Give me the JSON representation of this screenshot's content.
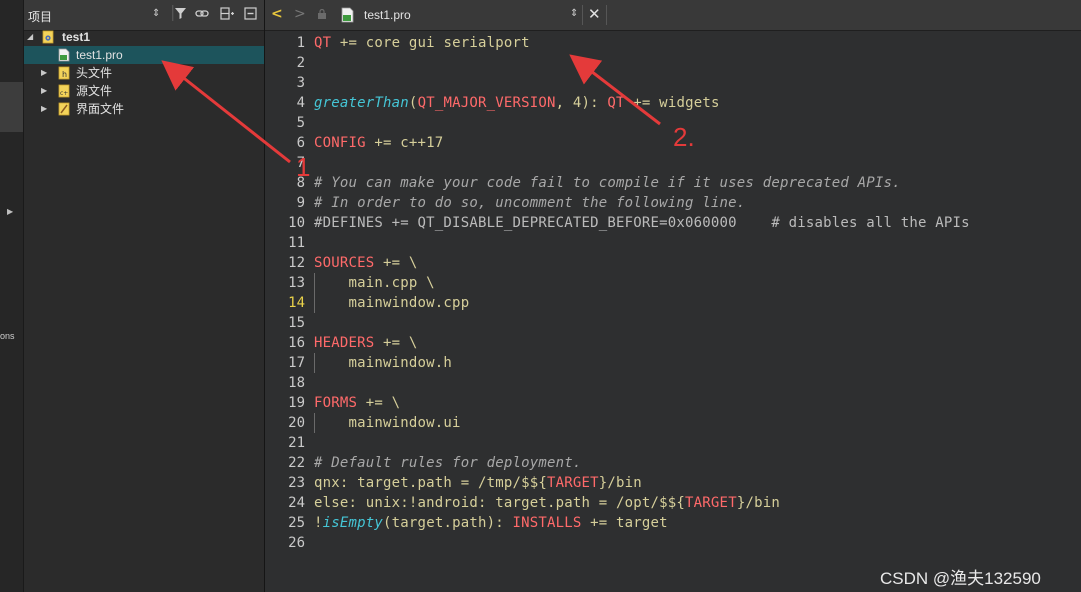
{
  "mode_strip": {
    "partial_label": "ons"
  },
  "project_panel": {
    "title": "项目",
    "tree": [
      {
        "label": "test1",
        "kind": "project",
        "expanded": true
      },
      {
        "label": "test1.pro",
        "kind": "pro-file",
        "selected": true
      },
      {
        "label": "头文件",
        "kind": "headers-folder",
        "expanded": false
      },
      {
        "label": "源文件",
        "kind": "sources-folder",
        "expanded": false
      },
      {
        "label": "界面文件",
        "kind": "forms-folder",
        "expanded": false
      }
    ]
  },
  "editor": {
    "file_name": "test1.pro",
    "current_line": "14",
    "line_numbers": [
      "1",
      "2",
      "3",
      "4",
      "5",
      "6",
      "7",
      "8",
      "9",
      "10",
      "11",
      "12",
      "13",
      "14",
      "15",
      "16",
      "17",
      "18",
      "19",
      "20",
      "21",
      "22",
      "23",
      "24",
      "25",
      "26"
    ],
    "lines": [
      [
        {
          "t": "QT",
          "c": "k"
        },
        {
          "t": " += core gui serialport",
          "c": "p"
        }
      ],
      [],
      [],
      [
        {
          "t": "greaterThan",
          "c": "f"
        },
        {
          "t": "(",
          "c": "p"
        },
        {
          "t": "QT_MAJOR_VERSION",
          "c": "k"
        },
        {
          "t": ", 4): ",
          "c": "p"
        },
        {
          "t": "QT",
          "c": "k"
        },
        {
          "t": " += widgets",
          "c": "p"
        }
      ],
      [],
      [
        {
          "t": "CONFIG",
          "c": "k"
        },
        {
          "t": " += c++17",
          "c": "p"
        }
      ],
      [],
      [
        {
          "t": "# You can make your code fail to compile if it uses deprecated APIs.",
          "c": "c"
        }
      ],
      [
        {
          "t": "# In order to do so, uncomment the following line.",
          "c": "c"
        }
      ],
      [
        {
          "t": "#DEFINES += QT_DISABLE_DEPRECATED_BEFORE=0x060000    # disables all the APIs",
          "c": "d"
        }
      ],
      [],
      [
        {
          "t": "SOURCES",
          "c": "k"
        },
        {
          "t": " += \\",
          "c": "p"
        }
      ],
      [
        {
          "t": "    main.cpp \\",
          "c": "p"
        }
      ],
      [
        {
          "t": "    mainwindow.cpp",
          "c": "p"
        }
      ],
      [],
      [
        {
          "t": "HEADERS",
          "c": "k"
        },
        {
          "t": " += \\",
          "c": "p"
        }
      ],
      [
        {
          "t": "    mainwindow.h",
          "c": "p"
        }
      ],
      [],
      [
        {
          "t": "FORMS",
          "c": "k"
        },
        {
          "t": " += \\",
          "c": "p"
        }
      ],
      [
        {
          "t": "    mainwindow.ui",
          "c": "p"
        }
      ],
      [],
      [
        {
          "t": "# Default rules for deployment.",
          "c": "c"
        }
      ],
      [
        {
          "t": "qnx: target.path = /tmp/$${",
          "c": "p"
        },
        {
          "t": "TARGET",
          "c": "k"
        },
        {
          "t": "}/bin",
          "c": "p"
        }
      ],
      [
        {
          "t": "else: unix:!android: target.path = /opt/$${",
          "c": "p"
        },
        {
          "t": "TARGET",
          "c": "k"
        },
        {
          "t": "}/bin",
          "c": "p"
        }
      ],
      [
        {
          "t": "!",
          "c": "p"
        },
        {
          "t": "isEmpty",
          "c": "f"
        },
        {
          "t": "(target.path): ",
          "c": "p"
        },
        {
          "t": "INSTALLS",
          "c": "k"
        },
        {
          "t": " += target",
          "c": "p"
        }
      ],
      []
    ]
  },
  "annotations": {
    "one": "1",
    "two": "2.",
    "color": "#e43a3a"
  },
  "watermark": "CSDN @渔夫132590"
}
